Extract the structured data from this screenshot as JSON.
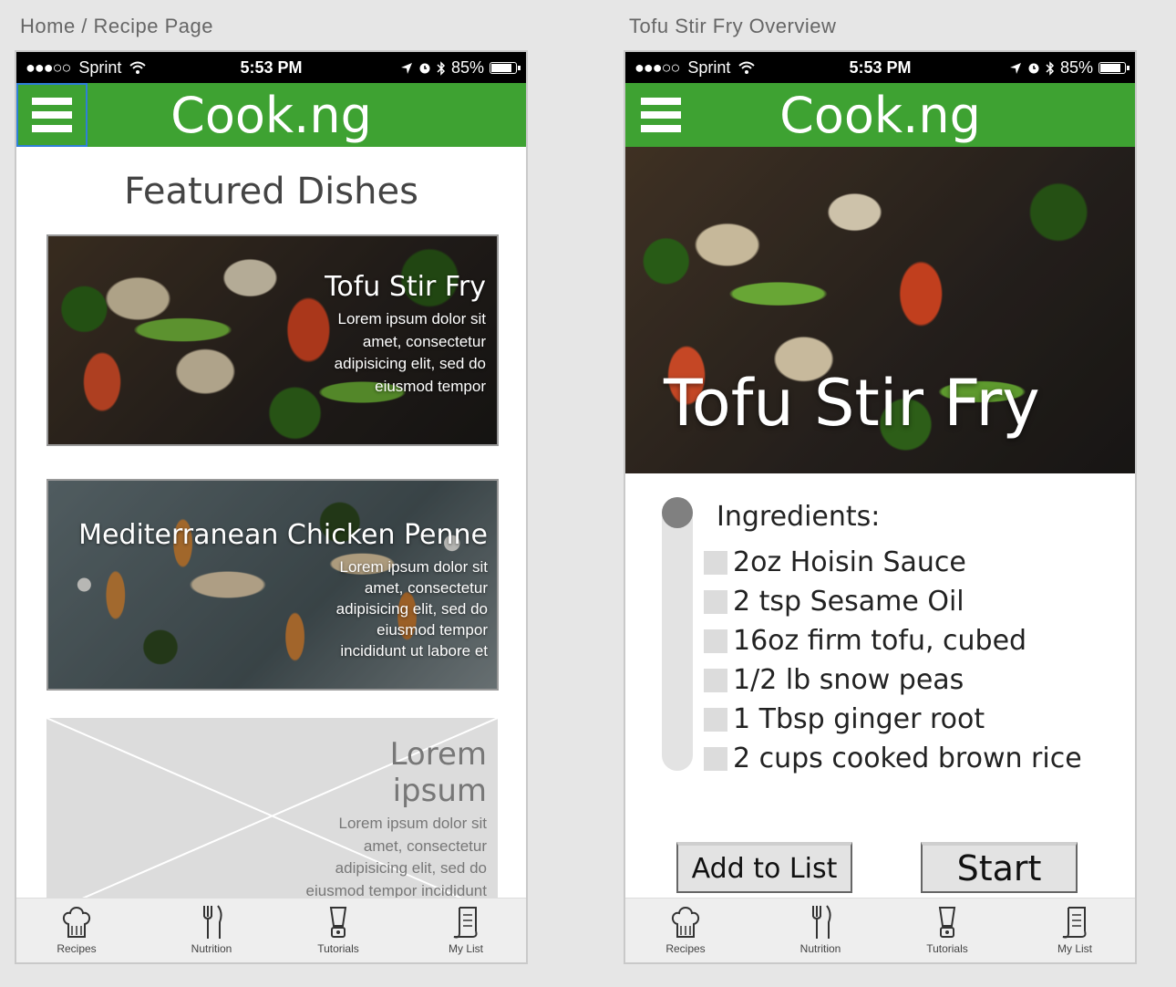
{
  "left": {
    "breadcrumb": "Home / Recipe Page",
    "status": {
      "dots": "●●●○○",
      "carrier": "Sprint",
      "time": "5:53 PM",
      "battery": "85%"
    },
    "brand": "Cook.ng",
    "heading": "Featured Dishes",
    "cards": [
      {
        "title": "Tofu Stir Fry",
        "description": "Lorem ipsum dolor sit amet, consectetur adipisicing elit, sed do eiusmod tempor"
      },
      {
        "title": "Mediterranean Chicken Penne",
        "description": "Lorem ipsum dolor sit amet, consectetur adipisicing elit, sed do eiusmod tempor incididunt ut labore et"
      },
      {
        "title": "Lorem ipsum",
        "description": "Lorem ipsum dolor sit amet, consectetur adipisicing elit, sed do eiusmod tempor incididunt ut labore et"
      }
    ]
  },
  "right": {
    "title": "Tofu Stir Fry Overview",
    "status": {
      "dots": "●●●○○",
      "carrier": "Sprint",
      "time": "5:53 PM",
      "battery": "85%"
    },
    "brand": "Cook.ng",
    "hero_title": "Tofu Stir Fry",
    "ingredients_heading": "Ingredients:",
    "ingredients": [
      "2oz Hoisin Sauce",
      "2 tsp Sesame Oil",
      "16oz firm tofu, cubed",
      "1/2 lb snow peas",
      "1 Tbsp ginger root",
      "2 cups cooked brown rice"
    ],
    "add_button": "Add to List",
    "start_button": "Start"
  },
  "tabs": [
    "Recipes",
    "Nutrition",
    "Tutorials",
    "My List"
  ],
  "colors": {
    "brand_green": "#3ea232",
    "selection_blue": "#2f7fd8"
  },
  "icons": {
    "menu": "hamburger-icon",
    "recipes": "chef-hat-icon",
    "nutrition": "fork-knife-icon",
    "tutorials": "blender-icon",
    "mylist": "scroll-list-icon"
  }
}
